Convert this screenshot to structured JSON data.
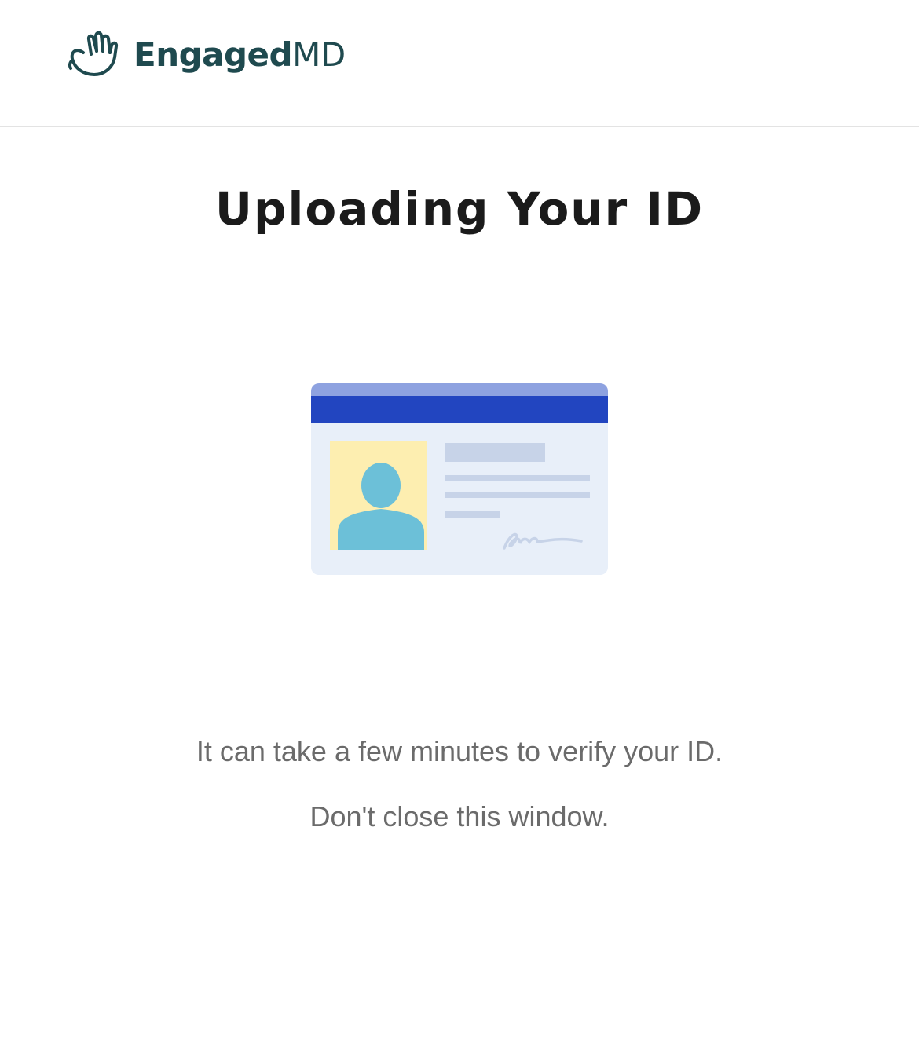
{
  "header": {
    "brand_bold": "Engaged",
    "brand_light": "MD",
    "logo_icon": "waving-hand-icon",
    "brand_color": "#1f4a4f"
  },
  "main": {
    "title": "Uploading Your ID",
    "illustration": "id-card-icon",
    "message_primary": "It can take a few minutes to verify your ID.",
    "message_secondary": "Don't close this window."
  },
  "colors": {
    "card_band": "#2245c0",
    "card_band_top": "#8ea2e0",
    "card_body": "#e8eff9",
    "photo_bg": "#fdeeb0",
    "person": "#6cc0d8",
    "text_primary": "#1b1b1b",
    "text_secondary": "#6b6b6b"
  }
}
